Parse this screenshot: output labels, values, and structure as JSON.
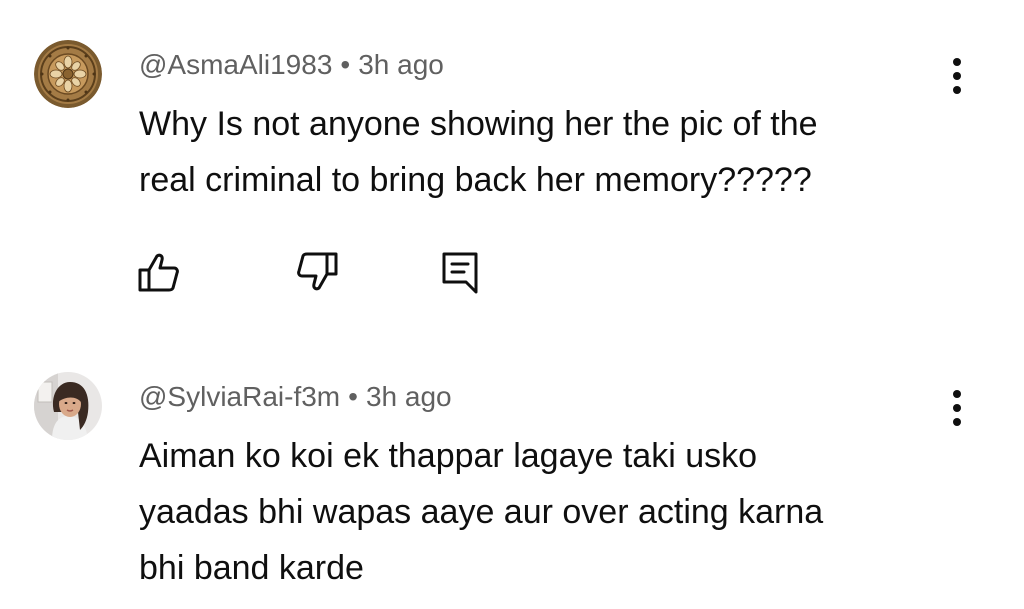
{
  "comments": [
    {
      "handle": "@AsmaAli1983",
      "separator": "•",
      "time": "3h ago",
      "lines": [
        "Why Is not anyone showing her the pic of the",
        "real criminal to bring back her memory?????"
      ],
      "avatar_icon": "ornamental-medallion-avatar",
      "actions": [
        "like-icon",
        "dislike-icon",
        "reply-icon"
      ]
    },
    {
      "handle": "@SylviaRai-f3m",
      "separator": "•",
      "time": "3h ago",
      "lines": [
        "Aiman ko koi ek thappar lagaye taki usko",
        "yaadas bhi wapas aaye aur over acting karna",
        "bhi band karde"
      ],
      "avatar_icon": "person-photo-avatar"
    }
  ],
  "colors": {
    "text_primary": "#0f0f0f",
    "text_secondary": "#606060",
    "background": "#ffffff"
  }
}
